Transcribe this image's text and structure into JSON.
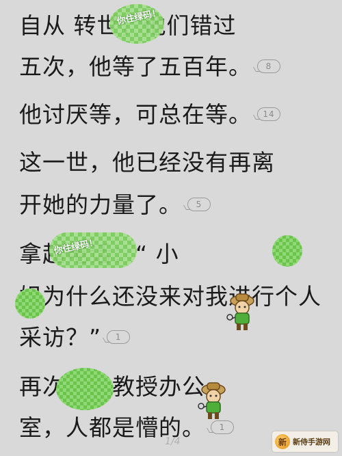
{
  "lines": [
    {
      "text": "自从      转世，他们错过",
      "badge": ""
    },
    {
      "text": "五次，他等了五百年。",
      "badge": "8"
    },
    {
      "text": "  他讨厌等，可总在等。",
      "badge": "14"
    },
    {
      "text": "  这一世，他已经没有再离",
      "badge": ""
    },
    {
      "text": "开她的力量了。",
      "badge": "5"
    },
    {
      "text": "          拿起电话：“    小",
      "badge": ""
    },
    {
      "text": "  姐为什么还没来对我进行个人",
      "badge": ""
    },
    {
      "text": "采访？”",
      "badge": "1"
    },
    {
      "text": "          再次走进教授办公",
      "badge": ""
    },
    {
      "text": "室，人都是懵的。",
      "badge": "1"
    }
  ],
  "stickers": {
    "top": "你住绿码！",
    "middle": "你住绿码！"
  },
  "page_indicator": "1/4",
  "logo": {
    "mark": "新",
    "text": "新侍手游网"
  },
  "colors": {
    "background": "#d9d9d9",
    "text": "#1a1a1a",
    "sticker_green": "#7ccd5e"
  }
}
